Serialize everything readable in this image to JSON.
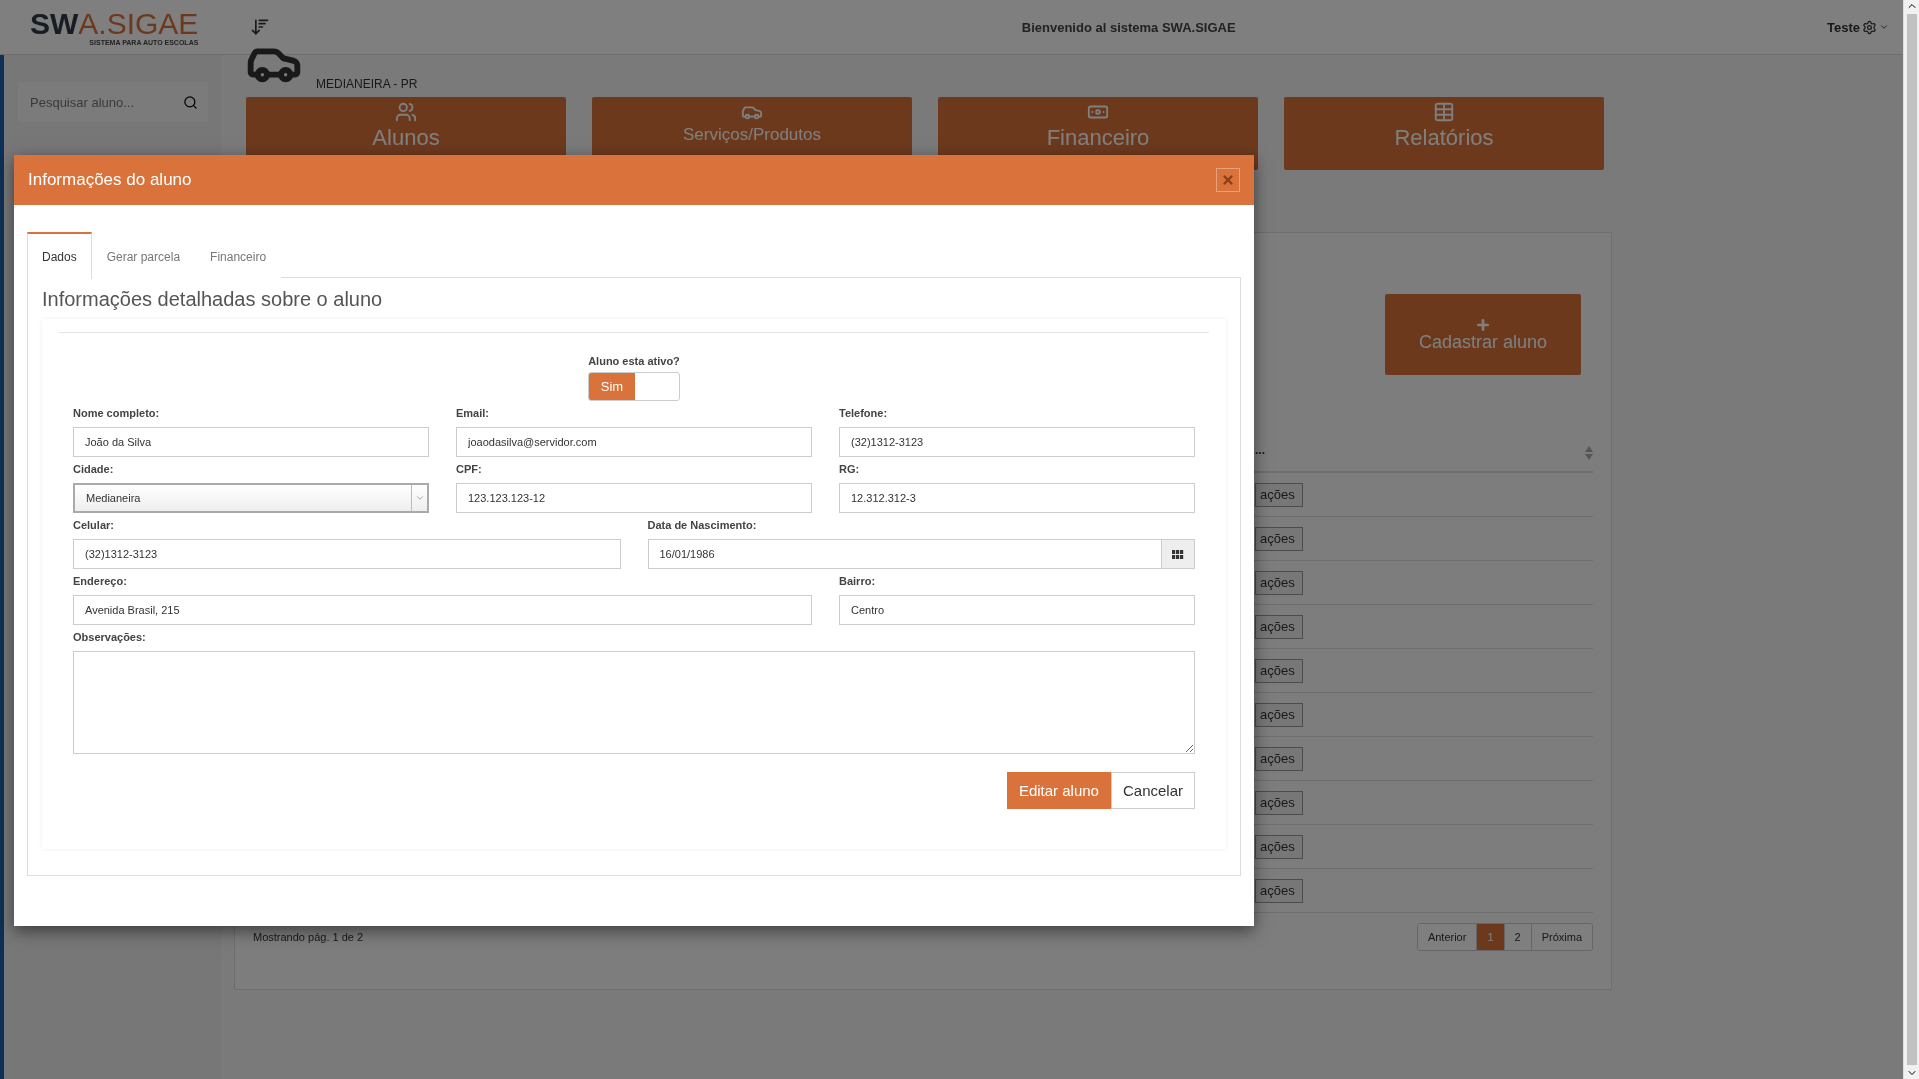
{
  "header": {
    "logo": {
      "dark": "SW",
      "accent": "A.SIGAE",
      "tagline": "SISTEMA PARA AUTO ESCOLAS"
    },
    "welcome": "Bienvenido al sistema SWA.SIGAE",
    "user": "Teste"
  },
  "sidebar": {
    "search_placeholder": "Pesquisar aluno..."
  },
  "location": "MEDIANEIRA - PR",
  "tiles": [
    {
      "label": "Alunos",
      "kind": "users"
    },
    {
      "label": "Serviços/Produtos",
      "kind": "car"
    },
    {
      "label": "Financeiro",
      "kind": "money"
    },
    {
      "label": "Relatórios",
      "kind": "table"
    }
  ],
  "list": {
    "add_button": "Cadastrar aluno",
    "column_1": "...",
    "rows": [
      {
        "action": "ações"
      },
      {
        "action": "ações"
      },
      {
        "action": "ações"
      },
      {
        "action": "ações"
      },
      {
        "action": "ações"
      },
      {
        "action": "ações"
      },
      {
        "action": "ações"
      },
      {
        "action": "ações"
      },
      {
        "action": "ações"
      },
      {
        "action": "ações"
      }
    ],
    "footer": "Mostrando pág. 1 de 2",
    "pagination": [
      {
        "label": "Anterior",
        "selected": false
      },
      {
        "label": "1",
        "selected": true
      },
      {
        "label": "2",
        "selected": false
      },
      {
        "label": "Próxima",
        "selected": false
      }
    ]
  },
  "modal": {
    "title": "Informações do aluno",
    "tabs": [
      {
        "label": "Dados",
        "selected": true
      },
      {
        "label": "Gerar parcela",
        "selected": false
      },
      {
        "label": "Financeiro",
        "selected": false
      }
    ],
    "heading": "Informações detalhadas sobre o aluno",
    "active": {
      "question": "Aluno esta ativo?",
      "label": "Sim",
      "on": true
    },
    "fields": [
      {
        "label": "Nome completo:",
        "value": "João da Silva",
        "kind": "text"
      },
      {
        "label": "Email:",
        "value": "joaodasilva@servidor.com",
        "kind": "text"
      },
      {
        "label": "Telefone:",
        "value": "(32)1312-3123",
        "kind": "text"
      },
      {
        "label": "Cidade:",
        "value": "Medianeira",
        "kind": "select"
      },
      {
        "label": "CPF:",
        "value": "123.123.123-12",
        "kind": "text"
      },
      {
        "label": "RG:",
        "value": "12.312.312-3",
        "kind": "text"
      },
      {
        "label": "Celular:",
        "value": "(32)1312-3123",
        "kind": "text"
      },
      {
        "label": "Data de Nascimento:",
        "value": "16/01/1986",
        "kind": "date"
      },
      {
        "label": "Endereço:",
        "value": "Avenida Brasil, 215",
        "kind": "text"
      },
      {
        "label": "Bairro:",
        "value": "Centro",
        "kind": "text"
      }
    ],
    "notes": {
      "label": "Observações:"
    },
    "buttons": [
      {
        "label": "Editar aluno",
        "kind": "primary"
      },
      {
        "label": "Cancelar",
        "kind": "secondary"
      }
    ]
  }
}
